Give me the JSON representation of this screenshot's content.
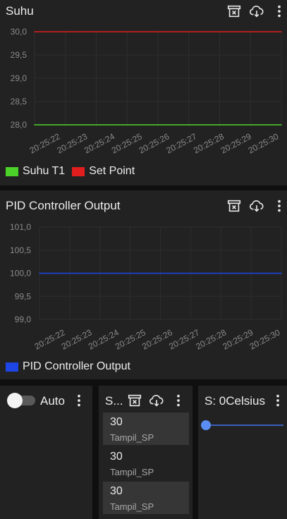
{
  "colors": {
    "background": "#0f0f0f",
    "card": "#222222",
    "grid": "#2e2e2e",
    "axis_text": "#8a8a8a",
    "suhu_t1": "#4cd32a",
    "set_point": "#e01e1e",
    "pid_output": "#1e46e6",
    "slider": "#5b8ef5"
  },
  "icons": {
    "archive": "archive-x-icon",
    "download": "cloud-download-icon",
    "menu": "more-vertical-icon"
  },
  "suhu_panel": {
    "title": "Suhu",
    "legend": [
      {
        "label": "Suhu T1",
        "color": "#4cd32a"
      },
      {
        "label": "Set Point",
        "color": "#e01e1e"
      }
    ]
  },
  "pid_panel": {
    "title": "PID Controller Output",
    "legend": [
      {
        "label": "PID Controller Output",
        "color": "#1e46e6"
      }
    ]
  },
  "auto_panel": {
    "label": "Auto",
    "toggle_on": false
  },
  "list_panel": {
    "title": "S...",
    "items": [
      {
        "value": "30",
        "label": "Tampil_SP"
      },
      {
        "value": "30",
        "label": "Tampil_SP"
      },
      {
        "value": "30",
        "label": "Tampil_SP"
      }
    ]
  },
  "slider_panel": {
    "title": "S: 0Celsius",
    "value": 0
  },
  "chart_data": [
    {
      "type": "line",
      "title": "Suhu",
      "x": [
        "20:25:22",
        "20:25:23",
        "20:25:24",
        "20:25:25",
        "20:25:26",
        "20:25:27",
        "20:25:28",
        "20:25:29",
        "20:25:30"
      ],
      "yticks": [
        "30,0",
        "29,5",
        "29,0",
        "28,5",
        "28,0"
      ],
      "ylim": [
        28.0,
        30.0
      ],
      "grid": true,
      "legend_position": "bottom-left",
      "series": [
        {
          "name": "Suhu T1",
          "values": [
            28,
            28,
            28,
            28,
            28,
            28,
            28,
            28,
            28
          ]
        },
        {
          "name": "Set Point",
          "values": [
            30,
            30,
            30,
            30,
            30,
            30,
            30,
            30,
            30
          ]
        }
      ]
    },
    {
      "type": "line",
      "title": "PID Controller Output",
      "x": [
        "20:25:22",
        "20:25:23",
        "20:25:24",
        "20:25:25",
        "20:25:26",
        "20:25:27",
        "20:25:28",
        "20:25:29",
        "20:25:30"
      ],
      "yticks": [
        "101,0",
        "100,5",
        "100,0",
        "99,5",
        "99,0"
      ],
      "ylim": [
        99.0,
        101.0
      ],
      "grid": true,
      "legend_position": "bottom-left",
      "series": [
        {
          "name": "PID Controller Output",
          "values": [
            100,
            100,
            100,
            100,
            100,
            100,
            100,
            100,
            100
          ]
        }
      ]
    }
  ]
}
